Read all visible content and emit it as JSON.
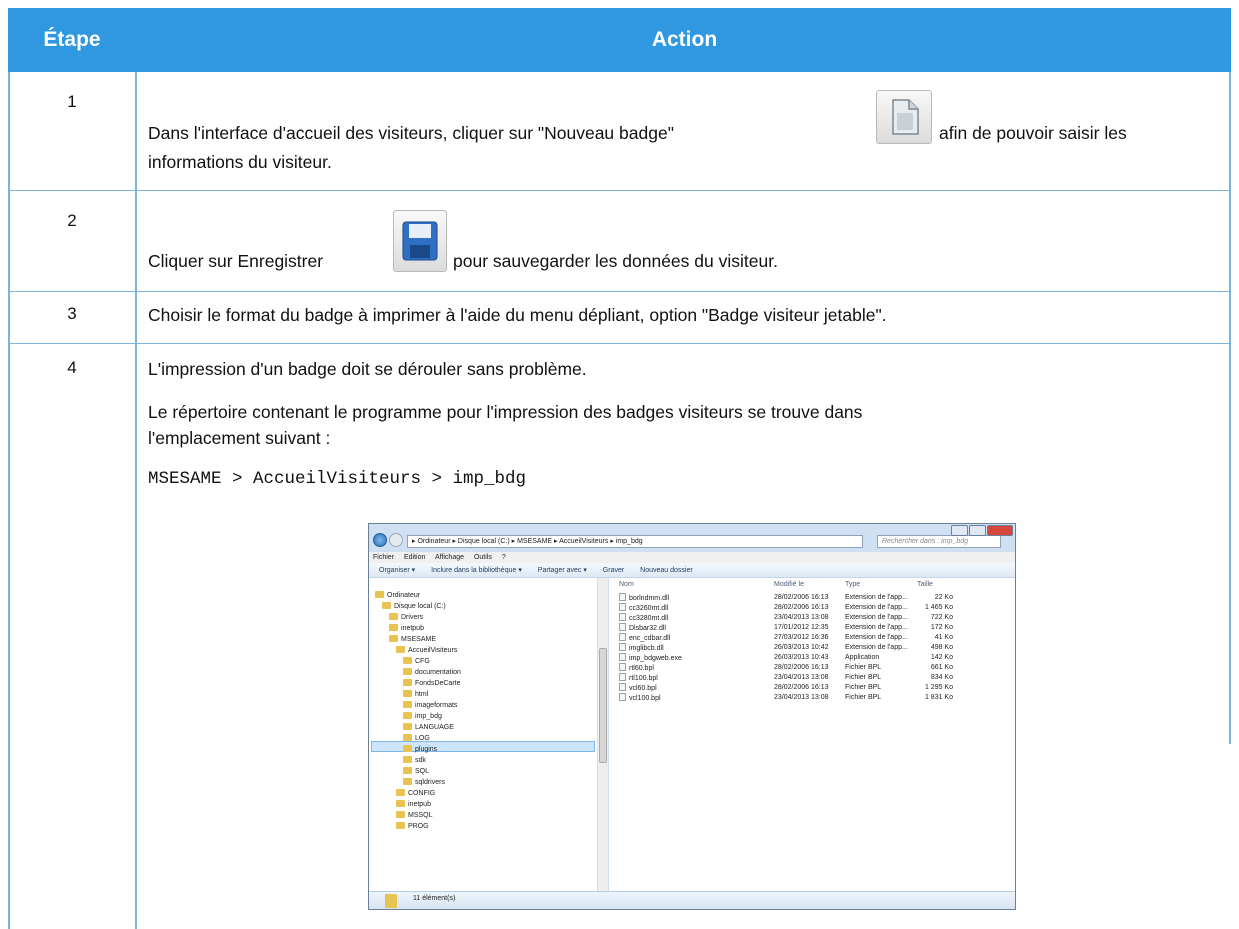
{
  "table": {
    "header": {
      "col_step": "Étape",
      "col_action": "Action"
    },
    "rows": [
      {
        "step": "1",
        "line1": "Dans l'interface d'accueil des visiteurs, cliquer sur \"Nouveau badge\"",
        "line1b": "afin de pouvoir saisir les",
        "line2": "informations du visiteur.",
        "icon": "new-document-icon"
      },
      {
        "step": "2",
        "line1": "Cliquer sur Enregistrer",
        "line1b": "pour sauvegarder les données du visiteur.",
        "icon": "floppy-disk-icon"
      },
      {
        "step": "3",
        "line1": "Choisir le format du badge à imprimer à l'aide du menu dépliant, option \"Badge visiteur jetable\"."
      },
      {
        "step": "4",
        "line1": "L'impression d'un badge doit se dérouler sans problème.",
        "line2": "Le répertoire contenant le programme pour l'impression des badges visiteurs se trouve dans",
        "line3": "l'emplacement suivant :",
        "path": "MSESAME > AccueilVisiteurs > imp_bdg"
      }
    ]
  },
  "explorer": {
    "address": "▸ Ordinateur ▸ Disque local (C:) ▸ MSESAME ▸ AccueilVisiteurs ▸ imp_bdg",
    "search_placeholder": "Rechercher dans : imp_bdg",
    "menu": [
      "Fichier",
      "Edition",
      "Affichage",
      "Outils",
      "?"
    ],
    "toolbar": [
      "Organiser ▾",
      "Inclure dans la bibliothèque ▾",
      "Partager avec ▾",
      "Graver",
      "Nouveau dossier"
    ],
    "tree": [
      {
        "label": "Ordinateur",
        "level": 0
      },
      {
        "label": "Disque local (C:)",
        "level": 1
      },
      {
        "label": "Drivers",
        "level": 2
      },
      {
        "label": "inetpub",
        "level": 2
      },
      {
        "label": "MSESAME",
        "level": 2
      },
      {
        "label": "AccueilVisiteurs",
        "level": 3
      },
      {
        "label": "CFG",
        "level": 4
      },
      {
        "label": "documentation",
        "level": 4
      },
      {
        "label": "FondsDeCarte",
        "level": 4
      },
      {
        "label": "html",
        "level": 4
      },
      {
        "label": "imageformats",
        "level": 4
      },
      {
        "label": "imp_bdg",
        "level": 4
      },
      {
        "label": "LANGUAGE",
        "level": 4
      },
      {
        "label": "LOG",
        "level": 4
      },
      {
        "label": "plugins",
        "level": 4
      },
      {
        "label": "sdk",
        "level": 4
      },
      {
        "label": "SQL",
        "level": 4
      },
      {
        "label": "sqldrivers",
        "level": 4
      },
      {
        "label": "CONFIG",
        "level": 3
      },
      {
        "label": "inetpub",
        "level": 3
      },
      {
        "label": "MSSQL",
        "level": 3
      },
      {
        "label": "PROG",
        "level": 3
      }
    ],
    "columns": [
      "Nom",
      "Modifié le",
      "Type",
      "Taille"
    ],
    "files": [
      [
        "borlndmm.dll",
        "28/02/2006 16:13",
        "Extension de l'app...",
        "22 Ko"
      ],
      [
        "cc3260mt.dll",
        "28/02/2006 16:13",
        "Extension de l'app...",
        "1 465 Ko"
      ],
      [
        "cc3280mt.dll",
        "23/04/2013 13:08",
        "Extension de l'app...",
        "722 Ko"
      ],
      [
        "Dlsbar32.dll",
        "17/01/2012 12:35",
        "Extension de l'app...",
        "172 Ko"
      ],
      [
        "enc_cdbar.dll",
        "27/03/2012 16:36",
        "Extension de l'app...",
        "41 Ko"
      ],
      [
        "imglibcb.dll",
        "26/03/2013 10:42",
        "Extension de l'app...",
        "498 Ko"
      ],
      [
        "imp_bdgweb.exe",
        "26/03/2013 10:43",
        "Application",
        "142 Ko"
      ],
      [
        "rtl60.bpl",
        "28/02/2006 16:13",
        "Fichier BPL",
        "661 Ko"
      ],
      [
        "rtl100.bpl",
        "23/04/2013 13:08",
        "Fichier BPL",
        "834 Ko"
      ],
      [
        "vcl60.bpl",
        "28/02/2006 16:13",
        "Fichier BPL",
        "1 295 Ko"
      ],
      [
        "vcl100.bpl",
        "23/04/2013 13:08",
        "Fichier BPL",
        "1 831 Ko"
      ]
    ],
    "status": "11 élément(s)"
  }
}
